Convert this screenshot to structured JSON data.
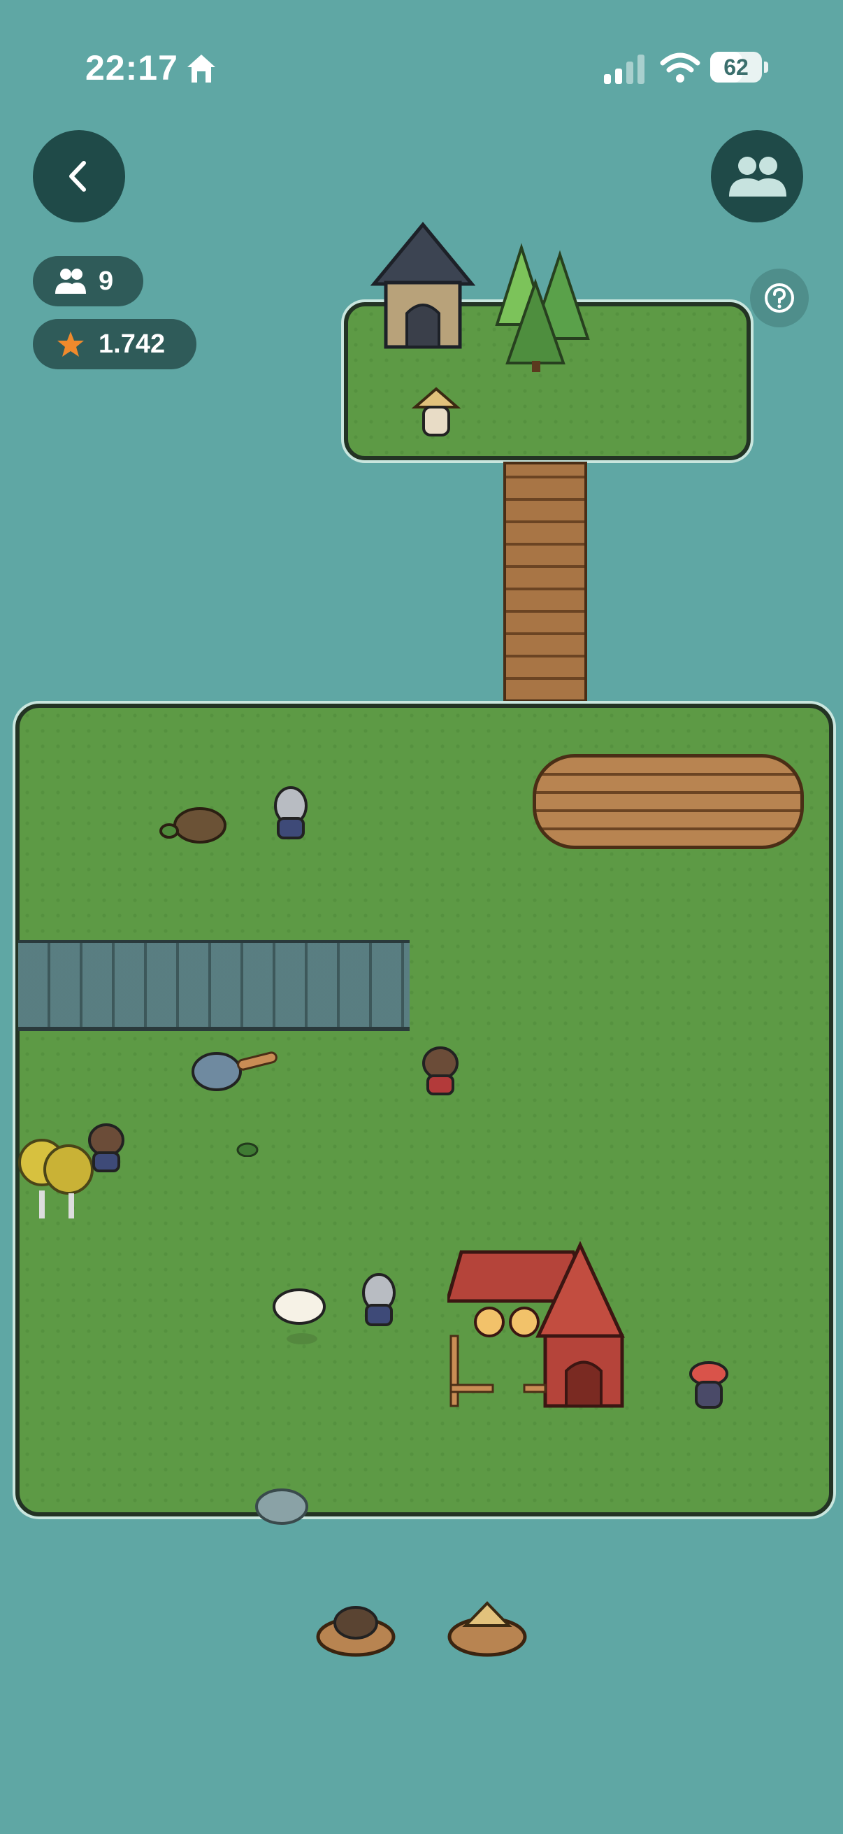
{
  "status_bar": {
    "time": "22:17",
    "battery_percent": "62",
    "battery_level": 0.62,
    "icons": [
      "home-icon",
      "cellular-signal-icon",
      "wifi-icon",
      "battery-icon"
    ]
  },
  "header": {
    "back_icon": "chevron-left-icon",
    "friends_icon": "people-icon",
    "help_icon": "question-mark-icon"
  },
  "stats": {
    "players_icon": "people-icon",
    "players_count": "9",
    "stars_icon": "star-icon",
    "stars_value": "1.742"
  },
  "colors": {
    "water": "#5fa7a4",
    "grass": "#5d9a45",
    "button_dark": "#1f4a48",
    "pill": "#2f5b59",
    "star": "#f08a2c"
  },
  "scene": {
    "structures": [
      "dark-roof-house",
      "pine-trees",
      "wooden-bridge",
      "wooden-dock",
      "red-barn",
      "stone-cliff",
      "yellow-bushes",
      "grey-rock"
    ],
    "characters": [
      "straw-hat-villager",
      "turtle",
      "helmet-knight",
      "shark-with-paddle",
      "hooded-villager-center",
      "hooded-villager-left",
      "sheep",
      "helmet-knight-2",
      "red-cap-villager"
    ],
    "boats": [
      "boat-boar",
      "boat-straw-hat"
    ]
  }
}
